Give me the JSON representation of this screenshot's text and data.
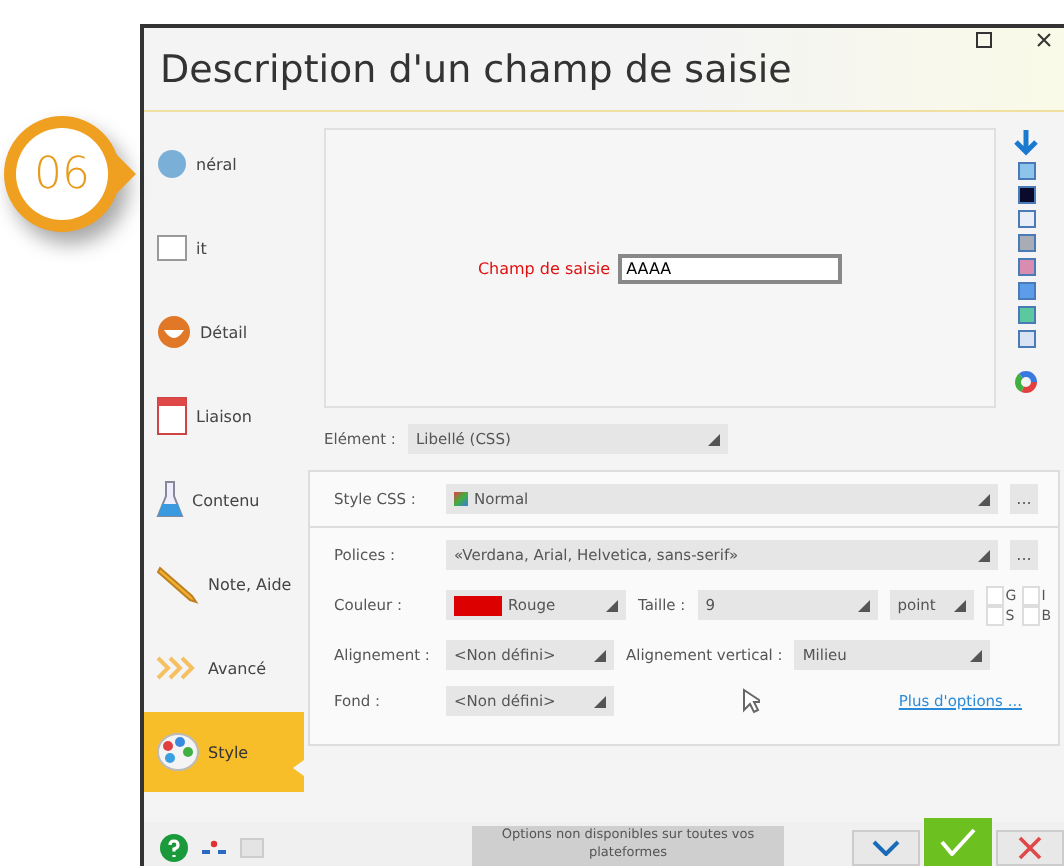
{
  "badge": {
    "text": "06"
  },
  "window": {
    "title": "Description d'un champ de saisie"
  },
  "sidebar": {
    "items": [
      {
        "label": "néral",
        "selected": false
      },
      {
        "label": "it",
        "selected": false
      },
      {
        "label": "Détail",
        "selected": false
      },
      {
        "label": "Liaison",
        "selected": false
      },
      {
        "label": "Contenu",
        "selected": false
      },
      {
        "label": "Note, Aide",
        "selected": false
      },
      {
        "label": "Avancé",
        "selected": false
      },
      {
        "label": "Style",
        "selected": true
      }
    ]
  },
  "preview": {
    "label": "Champ de saisie",
    "value": "AAAA"
  },
  "palette": [
    {
      "color": "#8cc4ec"
    },
    {
      "color": "#0a0a2a"
    },
    {
      "color": "#e8eef8"
    },
    {
      "color": "#a8acb4"
    },
    {
      "color": "#d88cb0"
    },
    {
      "color": "#5c9ce8"
    },
    {
      "color": "#5cc8a0"
    },
    {
      "color": "#d8e4f4"
    }
  ],
  "element": {
    "label": "Elément :",
    "value": "Libellé (CSS)"
  },
  "style_css": {
    "label": "Style CSS :",
    "value": "Normal",
    "more": "..."
  },
  "fonts": {
    "label": "Polices :",
    "value": "«Verdana, Arial, Helvetica, sans-serif»",
    "more": "..."
  },
  "color": {
    "label": "Couleur :",
    "color": "#dd0000",
    "value": "Rouge"
  },
  "size": {
    "label": "Taille :",
    "value": "9",
    "unit": "point"
  },
  "format": [
    {
      "label": "G",
      "checked": false
    },
    {
      "label": "I",
      "checked": false
    },
    {
      "label": "S",
      "checked": false
    },
    {
      "label": "B",
      "checked": false
    }
  ],
  "align": {
    "label": "Alignement :",
    "value": "<Non défini>"
  },
  "valign": {
    "label": "Alignement vertical :",
    "value": "Milieu"
  },
  "background": {
    "label": "Fond :",
    "value": "<Non défini>"
  },
  "more_link": "Plus d'options ...",
  "footer": {
    "note": "Options non disponibles sur toutes vos plateformes"
  }
}
